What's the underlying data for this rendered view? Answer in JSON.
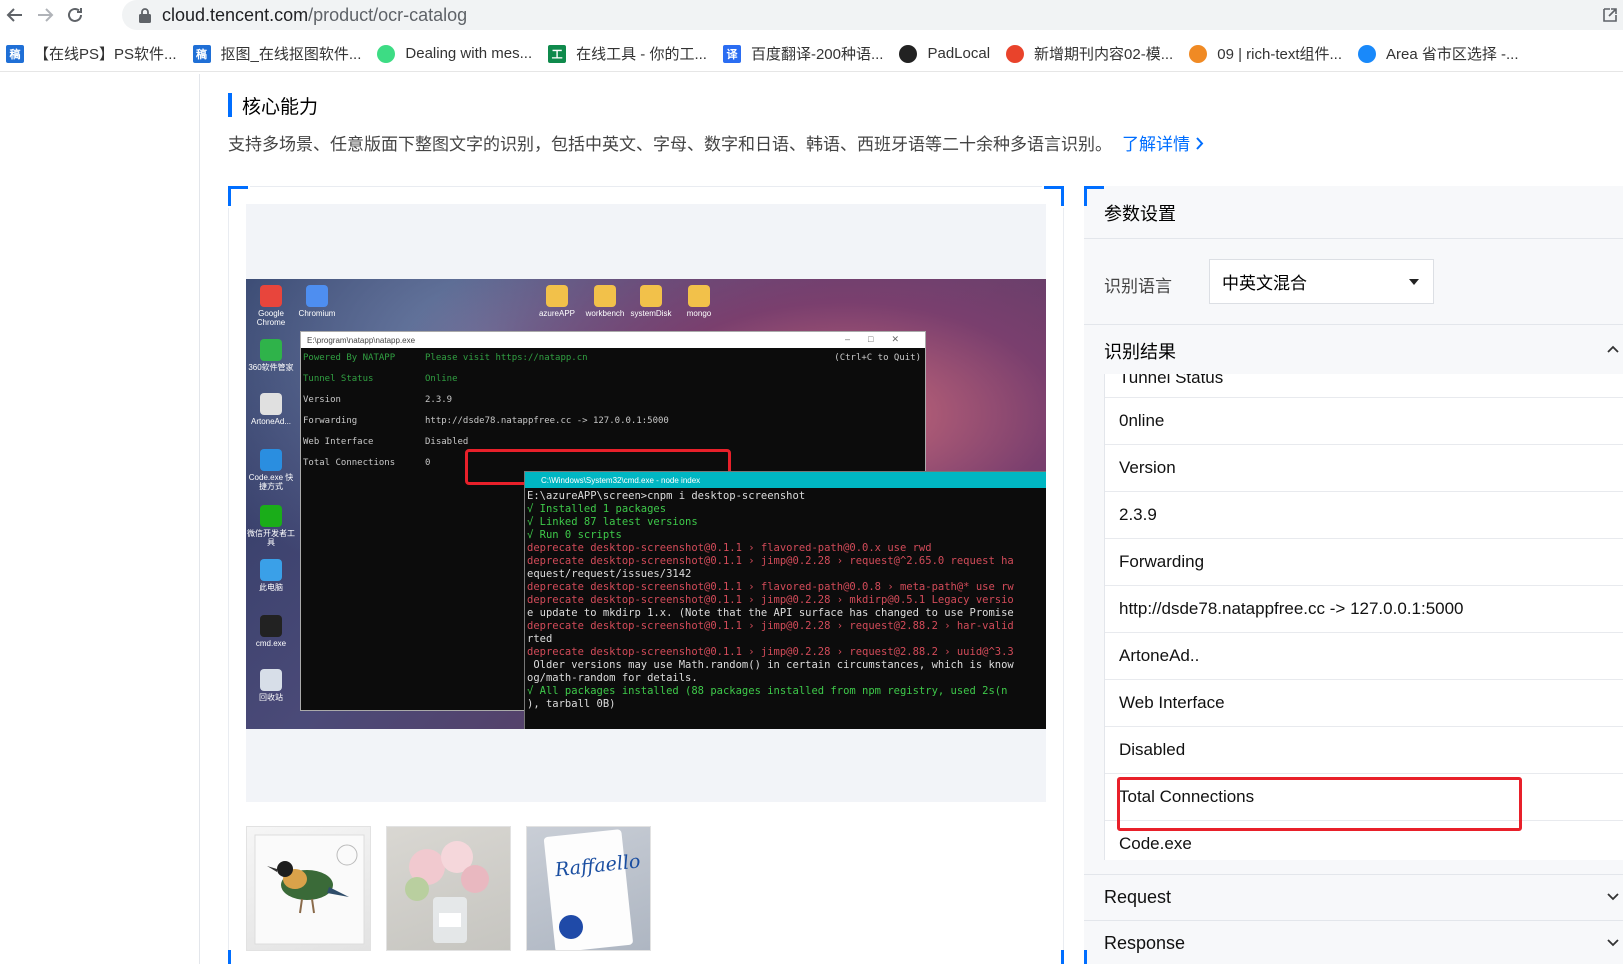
{
  "browser": {
    "url_host": "cloud.tencent.com",
    "url_path": "/product/ocr-catalog"
  },
  "bookmarks": [
    {
      "label": "【在线PS】PS软件...",
      "icon": "ps-icon",
      "color": "#1f6fd6",
      "glyph": "稿"
    },
    {
      "label": "抠图_在线抠图软件...",
      "icon": "koutu-icon",
      "color": "#1f6fd6",
      "glyph": "稿"
    },
    {
      "label": "Dealing with mes...",
      "icon": "android-icon",
      "color": "#3ddc84",
      "glyph": ""
    },
    {
      "label": "在线工具 - 你的工...",
      "icon": "tool-icon",
      "color": "#0f8a4c",
      "glyph": "工"
    },
    {
      "label": "百度翻译-200种语...",
      "icon": "translate-icon",
      "color": "#2b6df2",
      "glyph": "译"
    },
    {
      "label": "PadLocal",
      "icon": "padlocal-icon",
      "color": "#222222",
      "glyph": ""
    },
    {
      "label": "新增期刊内容02-模...",
      "icon": "fire-icon",
      "color": "#e9432b",
      "glyph": ""
    },
    {
      "label": "09 | rich-text组件...",
      "icon": "geek-icon",
      "color": "#f08a24",
      "glyph": ""
    },
    {
      "label": "Area 省市区选择 -...",
      "icon": "vant-icon",
      "color": "#1989fa",
      "glyph": ""
    }
  ],
  "section": {
    "title": "核心能力",
    "description": "支持多场景、任意版面下整图文字的识别，包括中英文、字母、数字和日语、韩语、西班牙语等二十余种多语言识别。",
    "more_link": "了解详情"
  },
  "screenshot": {
    "desktop_icons": [
      {
        "label": "Google Chrome",
        "color": "#e8453c"
      },
      {
        "label": "360软件管家",
        "color": "#2fb34a"
      },
      {
        "label": "ArtoneAd...",
        "color": "#e0e0e0"
      },
      {
        "label": "Code.exe 快捷方式",
        "color": "#2a8ee0"
      },
      {
        "label": "微信开发者工具",
        "color": "#1aad19"
      },
      {
        "label": "此电脑",
        "color": "#3aa0e8"
      },
      {
        "label": "cmd.exe",
        "color": "#222222"
      },
      {
        "label": "回收站",
        "color": "#d7dee8"
      }
    ],
    "top_icons": [
      {
        "label": "Chromium",
        "color": "#4e8ef0"
      },
      {
        "label": "azureAPP",
        "color": "#f2c14a"
      },
      {
        "label": "workbench",
        "color": "#f2c14a"
      },
      {
        "label": "systemDisk",
        "color": "#f2c14a"
      },
      {
        "label": "mongo",
        "color": "#f2c14a"
      }
    ],
    "natapp_title": "E:\\program\\natapp\\natapp.exe",
    "natapp_rows": [
      {
        "k": "Powered By NATAPP",
        "v": "Please visit https://natapp.cn",
        "extra": "(Ctrl+C to Quit)"
      },
      {
        "k": "Tunnel Status",
        "v": "Online",
        "extra": ""
      },
      {
        "k": "Version",
        "v": "2.3.9",
        "extra": ""
      },
      {
        "k": "Forwarding",
        "v": "http://dsde78.natappfree.cc -> 127.0.0.1:5000",
        "extra": ""
      },
      {
        "k": "Web Interface",
        "v": "Disabled",
        "extra": ""
      },
      {
        "k": "Total Connections",
        "v": "0",
        "extra": ""
      }
    ],
    "cmd_title": "C:\\Windows\\System32\\cmd.exe - node index",
    "cmd_lines": [
      {
        "t": "E:\\azureAPP\\screen>cnpm i desktop-screenshot",
        "c": ""
      },
      {
        "t": "√ Installed 1 packages",
        "c": "ok"
      },
      {
        "t": "√ Linked 87 latest versions",
        "c": "ok"
      },
      {
        "t": "√ Run 0 scripts",
        "c": "ok"
      },
      {
        "t": "deprecate desktop-screenshot@0.1.1 › flavored-path@0.0.x use rwd",
        "c": "dep"
      },
      {
        "t": "deprecate desktop-screenshot@0.1.1 › jimp@0.2.28 › request@^2.65.0 request ha",
        "c": "dep"
      },
      {
        "t": "equest/request/issues/3142",
        "c": ""
      },
      {
        "t": "deprecate desktop-screenshot@0.1.1 › flavored-path@0.0.8 › meta-path@* use rw",
        "c": "dep"
      },
      {
        "t": "deprecate desktop-screenshot@0.1.1 › jimp@0.2.28 › mkdirp@0.5.1 Legacy versio",
        "c": "dep"
      },
      {
        "t": "e update to mkdirp 1.x. (Note that the API surface has changed to use Promise",
        "c": ""
      },
      {
        "t": "deprecate desktop-screenshot@0.1.1 › jimp@0.2.28 › request@2.88.2 › har-valid",
        "c": "dep"
      },
      {
        "t": "rted",
        "c": ""
      },
      {
        "t": "deprecate desktop-screenshot@0.1.1 › jimp@0.2.28 › request@2.88.2 › uuid@^3.3",
        "c": "dep"
      },
      {
        "t": " Older versions may use Math.random() in certain circumstances, which is know",
        "c": ""
      },
      {
        "t": "og/math-random for details.",
        "c": ""
      },
      {
        "t": "√ All packages installed (88 packages installed from npm registry, used 2s(n",
        "c": "ok"
      },
      {
        "t": "), tarball 0B)",
        "c": ""
      }
    ]
  },
  "panel": {
    "title": "参数设置",
    "lang_label": "识别语言",
    "lang_value": "中英文混合",
    "result_title": "识别结果",
    "results": [
      "Tunnel Status",
      "0nline",
      "Version",
      "2.3.9",
      "Forwarding",
      "http://dsde78.natappfree.cc -> 127.0.0.1:5000",
      "ArtoneAd..",
      "Web Interface",
      "Disabled",
      "Total Connections",
      "Code.exe"
    ],
    "request_label": "Request",
    "response_label": "Response"
  },
  "colors": {
    "accent": "#006eff",
    "highlight": "#e8202a"
  }
}
